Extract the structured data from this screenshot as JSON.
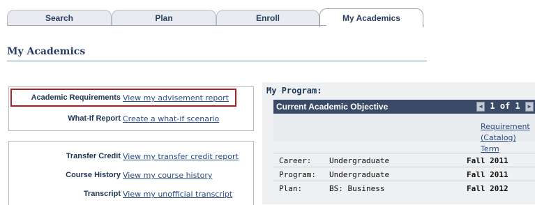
{
  "tabs": [
    {
      "label": "Search",
      "active": false
    },
    {
      "label": "Plan",
      "active": false
    },
    {
      "label": "Enroll",
      "active": false
    },
    {
      "label": "My Academics",
      "active": true
    }
  ],
  "page": {
    "title": "My Academics"
  },
  "sections": {
    "top": [
      {
        "label": "Academic Requirements",
        "link": "View my advisement report",
        "highlighted": true
      },
      {
        "label": "What-If Report",
        "link": "Create a what-if scenario"
      }
    ],
    "bottom": [
      {
        "label": "Transfer Credit",
        "link": "View my transfer credit report"
      },
      {
        "label": "Course History",
        "link": "View my course history"
      },
      {
        "label": "Transcript",
        "link": "View my unofficial transcript"
      }
    ]
  },
  "program": {
    "title": "My Program:",
    "objective_title": "Current Academic Objective",
    "pager": "1 of 1",
    "requirement_term_link_line1": "Requirement",
    "requirement_term_link_line2": "(Catalog) Term",
    "rows": [
      {
        "label": "Career:",
        "value": "Undergraduate",
        "term": "Fall 2011"
      },
      {
        "label": "Program:",
        "value": "Undergraduate",
        "term": "Fall 2011"
      },
      {
        "label": "Plan:",
        "value": "BS: Business",
        "term": "Fall 2012"
      }
    ]
  },
  "colors": {
    "header_bar": "#3a4b68",
    "highlight_border": "#b01e24",
    "label_text": "#1f3658",
    "link_text": "#2a4c86"
  }
}
